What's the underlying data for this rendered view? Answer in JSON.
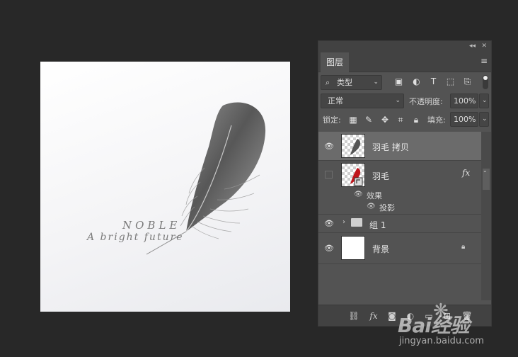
{
  "canvas": {
    "title_text": "NOBLE",
    "tagline": "A bright future"
  },
  "panel": {
    "tab_label": "图层",
    "filter": {
      "type_label": "类型"
    },
    "blend_mode": "正常",
    "opacity": {
      "label": "不透明度:",
      "value": "100%"
    },
    "lock": {
      "label": "锁定:"
    },
    "fill": {
      "label": "填充:",
      "value": "100%"
    },
    "layers": [
      {
        "name": "羽毛  拷贝",
        "visible": true,
        "selected": true
      },
      {
        "name": "羽毛",
        "visible": false,
        "effects_label": "效果",
        "effect_item": "投影"
      },
      {
        "name": "组 1",
        "visible": true,
        "type": "group"
      },
      {
        "name": "背景",
        "visible": true,
        "locked": true
      }
    ]
  },
  "icons": {
    "filter_icons": [
      "image-filter-icon",
      "adjustment-filter-icon",
      "type-filter-icon",
      "shape-filter-icon",
      "smart-object-filter-icon"
    ],
    "lock_icons": [
      "lock-transparent-icon",
      "lock-image-icon",
      "lock-position-icon",
      "lock-artboard-icon",
      "lock-all-icon"
    ],
    "bottom_icons": [
      "link-layers-icon",
      "fx-icon",
      "add-mask-icon",
      "adjustment-layer-icon",
      "new-group-icon",
      "new-layer-icon",
      "delete-icon"
    ]
  },
  "watermark": {
    "logo": "Bai经验",
    "url": "jingyan.baidu.com"
  },
  "colors": {
    "background": "#282828",
    "panel": "#535353",
    "selected_row": "#6b6b6b"
  }
}
